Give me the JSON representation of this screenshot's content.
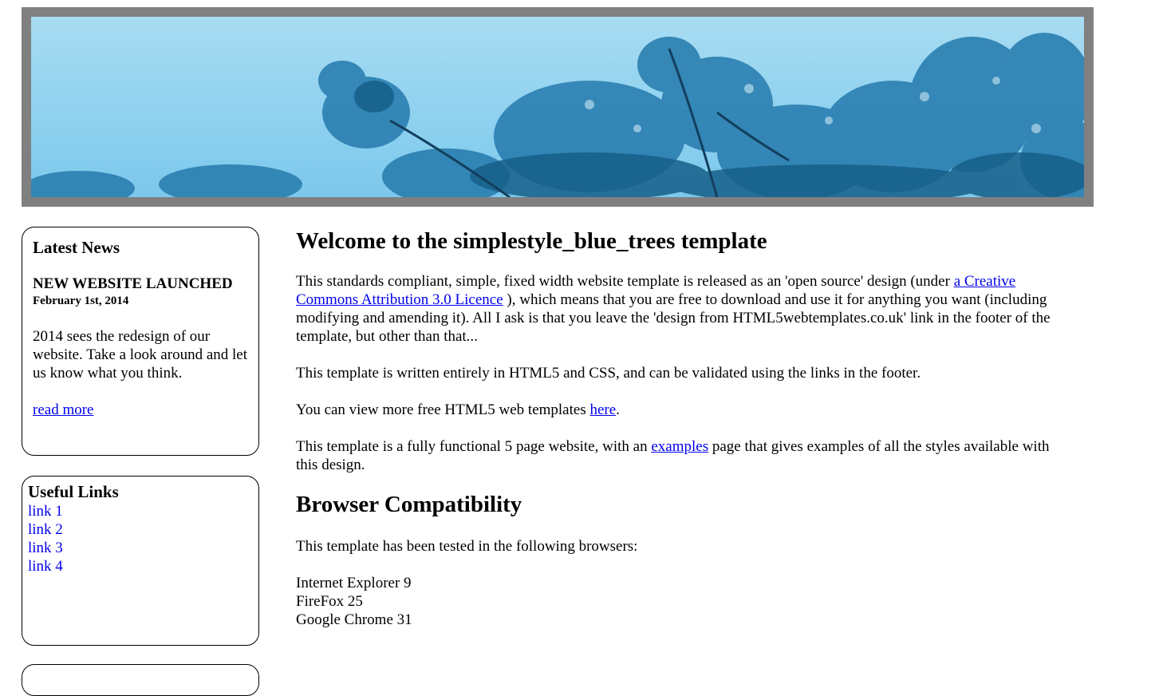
{
  "banner": {
    "image": "blue-trees-photo"
  },
  "colors": {
    "banner_frame": "#808080",
    "link": "#0000ee",
    "sky": "#8fd1ef",
    "foliage": "#1f6f9a"
  },
  "sidebar": {
    "news": {
      "heading": "Latest News",
      "title": "NEW WEBSITE LAUNCHED",
      "date": "February 1st, 2014",
      "text": "2014 sees the redesign of our website. Take a look around and let us know what you think.",
      "more_link": "read more"
    },
    "useful_links": {
      "heading": "Useful Links",
      "items": [
        {
          "label": "link 1"
        },
        {
          "label": "link 2"
        },
        {
          "label": "link 3"
        },
        {
          "label": "link 4"
        }
      ]
    }
  },
  "main": {
    "title": "Welcome to the simplestyle_blue_trees template",
    "p1": {
      "before": "This standards compliant, simple, fixed width website template is released as an 'open source' design (under ",
      "link": "a Creative Commons Attribution 3.0 Licence",
      "after": " ), which means that you are free to download and use it for anything you want (including modifying and amending it). All I ask is that you leave the 'design from HTML5webtemplates.co.uk' link in the footer of the template, but other than that..."
    },
    "p2": "This template is written entirely in HTML5 and CSS, and can be validated using the links in the footer.",
    "p3": {
      "before": "You can view more free HTML5 web templates ",
      "link": "here",
      "after": "."
    },
    "p4": {
      "before": "This template is a fully functional 5 page website, with an ",
      "link": "examples",
      "after": " page that gives examples of all the styles available with this design."
    },
    "compat_heading": "Browser Compatibility",
    "compat_intro": "This template has been tested in the following browsers:",
    "browsers": [
      "Internet Explorer 9",
      "FireFox 25",
      "Google Chrome 31"
    ]
  }
}
